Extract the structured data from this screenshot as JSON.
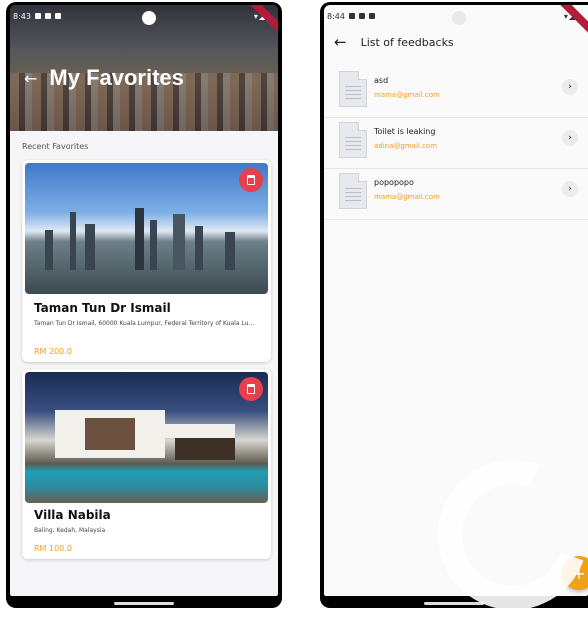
{
  "phone1": {
    "status": {
      "time": "8:43",
      "right": "▾◢"
    },
    "header": {
      "title": "My Favorites",
      "back_icon": "arrow-left-icon"
    },
    "section_label": "Recent Favorites",
    "cards": [
      {
        "title": "Taman Tun Dr Ismail",
        "address": "Taman Tun Dr Ismail, 60000 Kuala Lumpur, Federal Territory of Kuala Lu...",
        "price": "RM 200.0"
      },
      {
        "title": "Villa Nabila",
        "address": "Baling, Kedah, Malaysia",
        "price": "RM 100.0"
      }
    ],
    "colors": {
      "accent": "#f0a019",
      "delete": "#e5404b"
    }
  },
  "phone2": {
    "status": {
      "time": "8:44",
      "right": "▾◢"
    },
    "appbar": {
      "title": "List of feedbacks"
    },
    "feedbacks": [
      {
        "title": "asd",
        "email": "mama@gmail.com"
      },
      {
        "title": "Toilet is leaking",
        "email": "adina@gmail.com"
      },
      {
        "title": "popopopo",
        "email": "mama@gmail.com"
      }
    ],
    "fab_label": "+"
  }
}
